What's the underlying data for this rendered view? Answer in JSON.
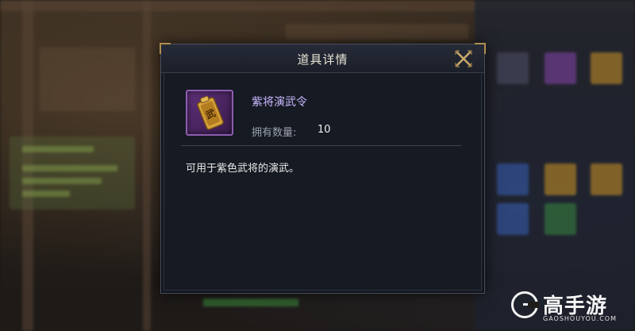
{
  "dialog": {
    "title": "道具详情",
    "close_icon": "close-x-icon",
    "item": {
      "icon": "purple-martial-token-icon",
      "name": "紫将演武令",
      "owned_label": "拥有数量:",
      "owned_value": "10"
    },
    "description": "可用于紫色武将的演武。"
  },
  "watermark": {
    "logo": "gaoshouyou-g-logo",
    "text_cn": "高手游",
    "text_en": "GAOSHOUYOU.COM"
  },
  "colors": {
    "dialog_bg": "#161a23",
    "item_name": "#c9b8ff",
    "purple_frame": "#8b5db0",
    "gold_accent": "#b08d4e"
  }
}
